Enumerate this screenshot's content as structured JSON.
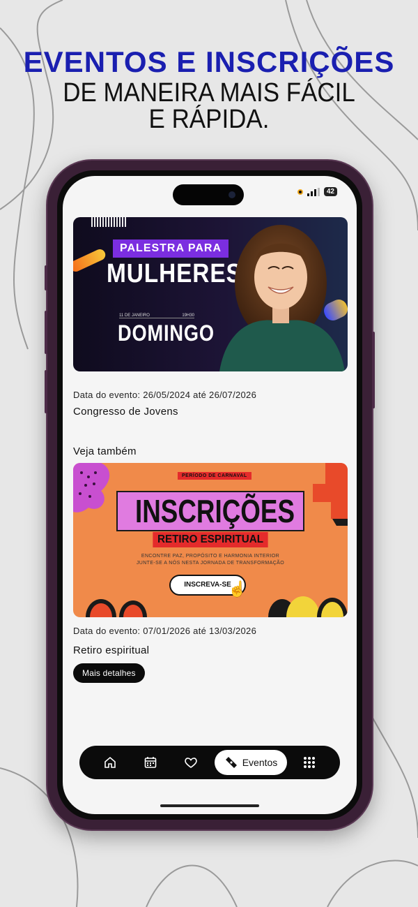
{
  "promo": {
    "headline": "EVENTOS E INSCRIÇÕES",
    "subline1": "DE MANEIRA MAIS FÁCIL",
    "subline2": "E RÁPIDA.",
    "headline_color": "#1a1fb0"
  },
  "status_bar": {
    "battery": "42"
  },
  "featured_event": {
    "banner": {
      "tag": "PALESTRA PARA",
      "title": "MULHERES",
      "small_left": "11 DE JANEIRO",
      "small_right": "19H30",
      "day": "DOMINGO"
    },
    "date_text": "Data do evento: 26/05/2024 até 26/07/2026",
    "title": "Congresso de Jovens"
  },
  "see_also": {
    "heading": "Veja também",
    "event": {
      "banner": {
        "tag": "PERÍODO DE CARNAVAL",
        "title": "INSCRIÇÕES",
        "subtitle": "RETIRO ESPIRITUAL",
        "line1": "ENCONTRE PAZ, PROPÓSITO E HARMONIA INTERIOR",
        "line2": "JUNTE-SE A NÓS NESTA JORNADA DE TRANSFORMAÇÃO",
        "button": "INSCREVA-SE"
      },
      "date_text": "Data do evento: 07/01/2026 até 13/03/2026",
      "title": "Retiro espiritual",
      "details_button": "Mais detalhes"
    }
  },
  "bottom_nav": {
    "items": [
      {
        "icon": "home-icon"
      },
      {
        "icon": "calendar-icon"
      },
      {
        "icon": "heart-icon"
      },
      {
        "icon": "ticket-icon",
        "label": "Eventos",
        "active": true
      },
      {
        "icon": "grid-icon"
      }
    ]
  }
}
